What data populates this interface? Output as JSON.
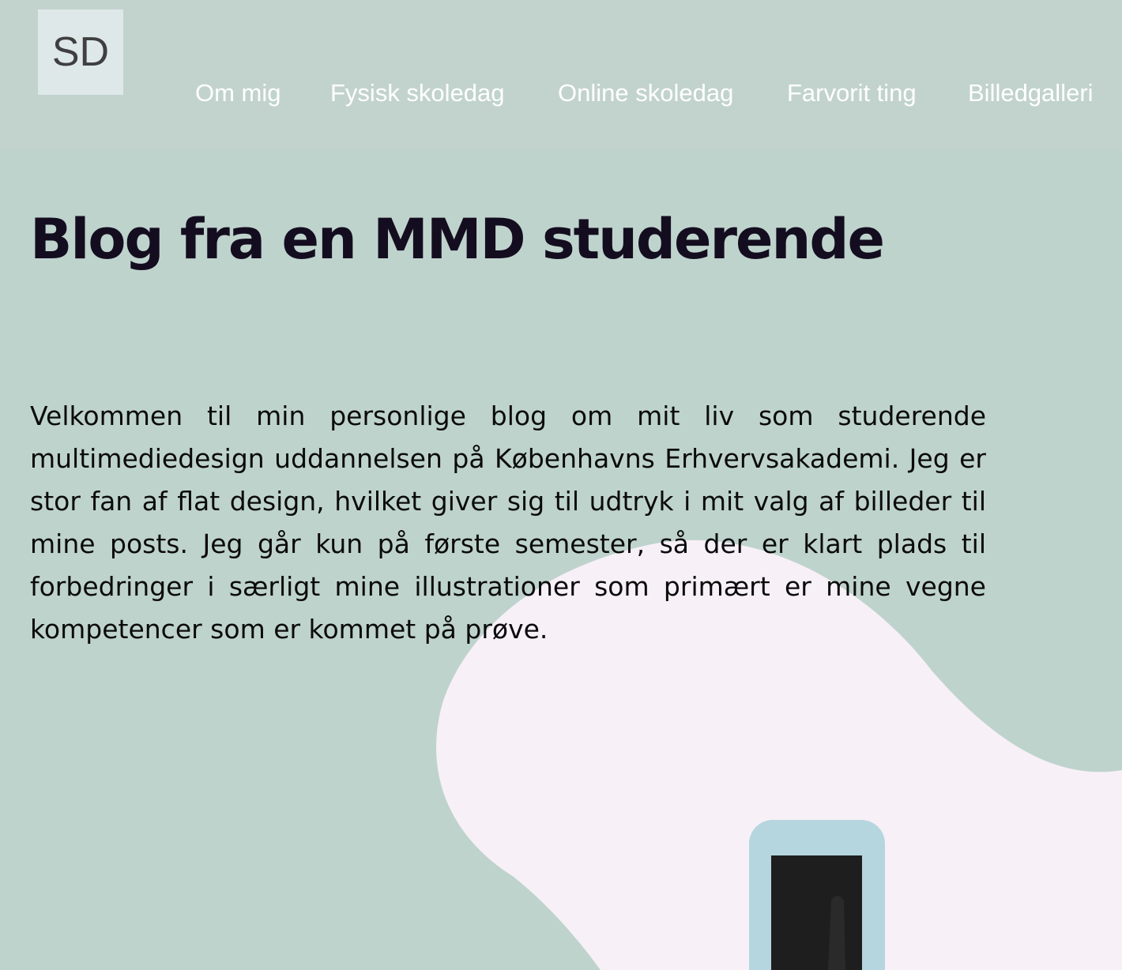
{
  "header": {
    "logo_text": "SD",
    "nav": [
      {
        "label": "Om mig"
      },
      {
        "label": "Fysisk skoledag"
      },
      {
        "label": "Online skoledag"
      },
      {
        "label": "Farvorit ting"
      },
      {
        "label": "Billedgalleri"
      }
    ]
  },
  "main": {
    "title": "Blog fra en MMD studerende",
    "intro": "Velkommen til min personlige blog om mit liv som studerende multimediedesign uddannelsen på Københavns Erhvervsakademi. Jeg er stor fan af flat design, hvilket giver sig til udtryk i mit valg af billeder til mine posts. Jeg går kun på første semester, så der er klart plads til forbedringer i særligt mine illustrationer som primært er mine vegne kompetencer som er kommet på prøve."
  },
  "colors": {
    "page_background": "#bfd3cd",
    "header_background": "#c2d3cd",
    "logo_background": "#dfe8e9",
    "blob": "#f7f0f7",
    "phone_frame": "#b6d6df",
    "phone_screen": "#1e1e1e"
  },
  "icons": {
    "illustration": "phone-illustration-icon"
  }
}
